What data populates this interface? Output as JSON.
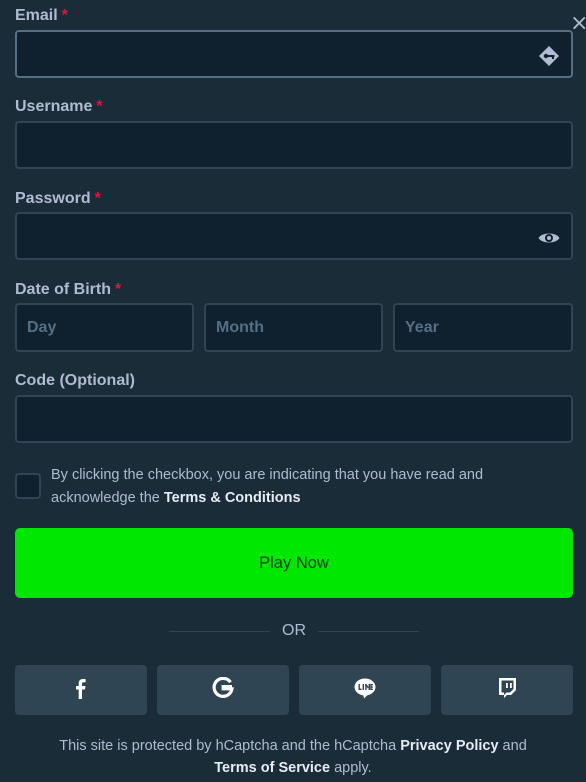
{
  "form": {
    "email": {
      "label": "Email",
      "required_mark": "*",
      "value": "",
      "icon": "password-manager-key-icon"
    },
    "username": {
      "label": "Username",
      "required_mark": "*",
      "value": ""
    },
    "password": {
      "label": "Password",
      "required_mark": "*",
      "value": "",
      "icon": "eye-icon"
    },
    "dob": {
      "label": "Date of Birth",
      "required_mark": "*",
      "day_placeholder": "Day",
      "month_placeholder": "Month",
      "year_placeholder": "Year"
    },
    "code": {
      "label": "Code (Optional)",
      "value": ""
    },
    "terms": {
      "text_before": "By clicking the checkbox, you are indicating that you have read and acknowledge the ",
      "link": "Terms & Conditions",
      "checked": false
    },
    "submit_label": "Play Now",
    "divider_text": "OR"
  },
  "social": [
    {
      "name": "facebook",
      "icon": "facebook-icon"
    },
    {
      "name": "google",
      "icon": "google-icon"
    },
    {
      "name": "line",
      "icon": "line-icon"
    },
    {
      "name": "twitch",
      "icon": "twitch-icon"
    }
  ],
  "footer": {
    "text1": "This site is protected by hCaptcha and the hCaptcha ",
    "privacy_link": "Privacy Policy",
    "text2": " and",
    "tos_link": "Terms of Service",
    "text3": " apply."
  },
  "close_label": "×",
  "colors": {
    "background": "#1a2c38",
    "input_bg": "#0f212e",
    "input_border": "#2f4553",
    "accent_green": "#00e701",
    "required_red": "#e9113c",
    "social_bg": "#2f4553"
  }
}
